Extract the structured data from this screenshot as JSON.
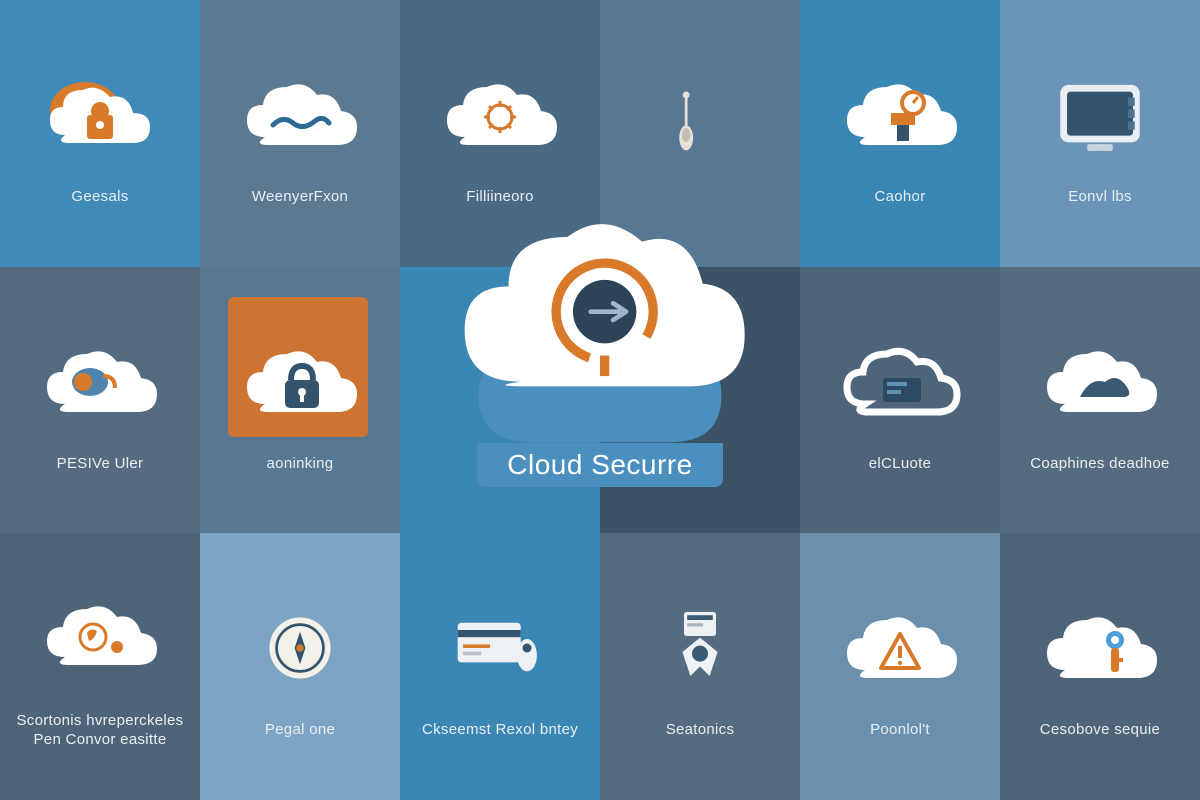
{
  "hero": {
    "label": "Cloud Securre"
  },
  "tiles": [
    {
      "id": "geesals",
      "label": "Geesals",
      "bg": "bg-blue-1"
    },
    {
      "id": "weenyerxon",
      "label": "WeenyerFxon",
      "bg": "bg-blue-2"
    },
    {
      "id": "filliineoro",
      "label": "Filliineoro",
      "bg": "bg-blue-3"
    },
    {
      "id": "cellcol3",
      "label": "",
      "bg": "bg-blue-4"
    },
    {
      "id": "caohor",
      "label": "Caohor",
      "bg": "bg-blue-5"
    },
    {
      "id": "eonvubs",
      "label": "Eonvl lbs",
      "bg": "bg-blue-6"
    },
    {
      "id": "pesiveuler",
      "label": "PESIVe Uler",
      "bg": "bg-gray-1"
    },
    {
      "id": "aoninking",
      "label": "aoninking",
      "bg": "bg-blue-4"
    },
    {
      "id": "centerL",
      "label": "",
      "bg": "bg-blue-5"
    },
    {
      "id": "centerR",
      "label": "",
      "bg": "bg-dark-1"
    },
    {
      "id": "elcuote",
      "label": "elCLuote",
      "bg": "bg-gray-2"
    },
    {
      "id": "coaphines",
      "label": "Coaphines deadhoe",
      "bg": "bg-gray-1"
    },
    {
      "id": "scortonis",
      "label": "Scortonis hvreperckeles Pen Convor easitte",
      "bg": "bg-gray-2"
    },
    {
      "id": "pegalone",
      "label": "Pegal one",
      "bg": "bg-light-1"
    },
    {
      "id": "ckseemst",
      "label": "Ckseemst Rexol bntey",
      "bg": "bg-blue-5"
    },
    {
      "id": "seatonics",
      "label": "Seatonics",
      "bg": "bg-gray-1"
    },
    {
      "id": "poonlolt",
      "label": "Poonlol't",
      "bg": "bg-light-2"
    },
    {
      "id": "cesobove",
      "label": "Cesobove sequie",
      "bg": "bg-gray-2"
    }
  ]
}
